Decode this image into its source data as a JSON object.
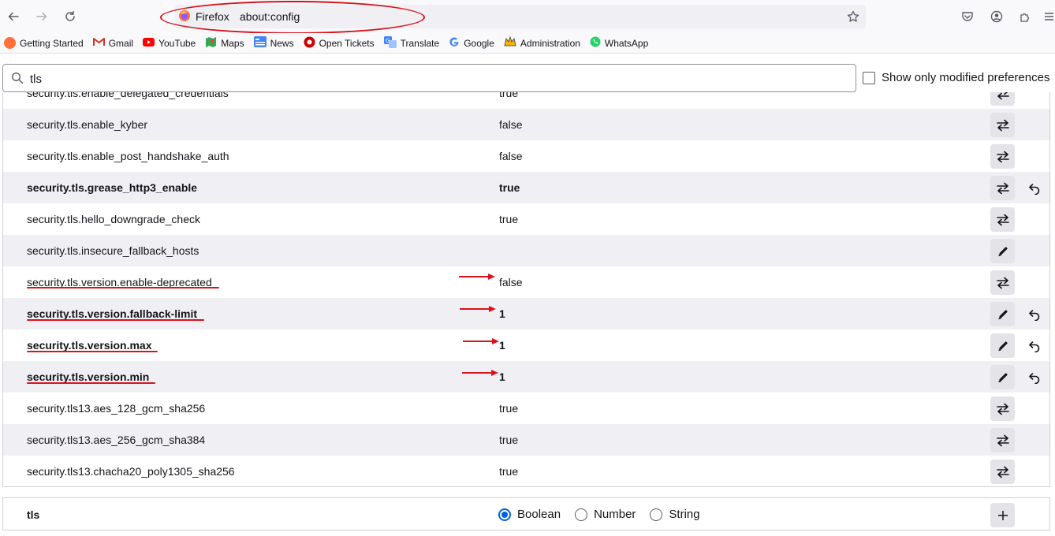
{
  "browser": {
    "identity_label": "Firefox",
    "url": "about:config"
  },
  "bookmarks": [
    {
      "label": "Getting Started",
      "icon": "firefox-icon",
      "color": "#e66000"
    },
    {
      "label": "Gmail",
      "icon": "gmail-icon",
      "color": "#d93025"
    },
    {
      "label": "YouTube",
      "icon": "youtube-icon",
      "color": "#ff0000"
    },
    {
      "label": "Maps",
      "icon": "maps-icon",
      "color": "#34a853"
    },
    {
      "label": "News",
      "icon": "news-icon",
      "color": "#4285f4"
    },
    {
      "label": "Open Tickets",
      "icon": "tickets-icon",
      "color": "#cc0000"
    },
    {
      "label": "Translate",
      "icon": "translate-icon",
      "color": "#4285f4"
    },
    {
      "label": "Google",
      "icon": "google-icon",
      "color": "#4285f4"
    },
    {
      "label": "Administration",
      "icon": "administration-icon",
      "color": "#f4b400"
    },
    {
      "label": "WhatsApp",
      "icon": "whatsapp-icon",
      "color": "#25d366"
    }
  ],
  "search": {
    "value": "tls"
  },
  "modified_filter_label": "Show only modified preferences",
  "prefs": [
    {
      "name": "security.tls.enable_delegated_credentials",
      "value": "true",
      "modified": false,
      "action": "toggle"
    },
    {
      "name": "security.tls.enable_kyber",
      "value": "false",
      "modified": false,
      "action": "toggle"
    },
    {
      "name": "security.tls.enable_post_handshake_auth",
      "value": "false",
      "modified": false,
      "action": "toggle"
    },
    {
      "name": "security.tls.grease_http3_enable",
      "value": "true",
      "modified": true,
      "action": "toggle"
    },
    {
      "name": "security.tls.hello_downgrade_check",
      "value": "true",
      "modified": false,
      "action": "toggle"
    },
    {
      "name": "security.tls.insecure_fallback_hosts",
      "value": "",
      "modified": false,
      "action": "edit"
    },
    {
      "name": "security.tls.version.enable-deprecated",
      "value": "false",
      "modified": false,
      "action": "toggle"
    },
    {
      "name": "security.tls.version.fallback-limit",
      "value": "1",
      "modified": true,
      "action": "edit"
    },
    {
      "name": "security.tls.version.max",
      "value": "1",
      "modified": true,
      "action": "edit"
    },
    {
      "name": "security.tls.version.min",
      "value": "1",
      "modified": true,
      "action": "edit"
    },
    {
      "name": "security.tls13.aes_128_gcm_sha256",
      "value": "true",
      "modified": false,
      "action": "toggle"
    },
    {
      "name": "security.tls13.aes_256_gcm_sha384",
      "value": "true",
      "modified": false,
      "action": "toggle"
    },
    {
      "name": "security.tls13.chacha20_poly1305_sha256",
      "value": "true",
      "modified": false,
      "action": "toggle"
    }
  ],
  "add_pref": {
    "name": "tls",
    "types": [
      "Boolean",
      "Number",
      "String"
    ],
    "selected_type": "Boolean"
  },
  "colors": {
    "annotation": "#d9121c",
    "accent": "#0061e0"
  }
}
